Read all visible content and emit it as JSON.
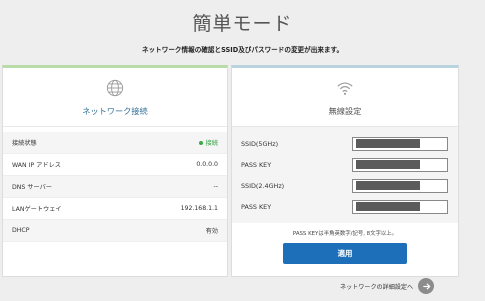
{
  "page": {
    "title": "簡単モード",
    "subtitle": "ネットワーク情報の確認とSSID及びパスワードの変更が出来ます。"
  },
  "network_card": {
    "icon": "globe-icon",
    "heading": "ネットワーク接続",
    "rows": [
      {
        "label": "接続状態",
        "value": "接続",
        "status": true
      },
      {
        "label": "WAN IP アドレス",
        "value": "0.0.0.0"
      },
      {
        "label": "DNS サーバー",
        "value": "--"
      },
      {
        "label": "LANゲートウェイ",
        "value": "192.168.1.1"
      },
      {
        "label": "DHCP",
        "value": "有効"
      }
    ]
  },
  "wireless_card": {
    "icon": "wifi-icon",
    "heading": "無線設定",
    "fields": [
      {
        "label": "SSID(5GHz)"
      },
      {
        "label": "PASS KEY"
      },
      {
        "label": "SSID(2.4GHz)"
      },
      {
        "label": "PASS KEY"
      }
    ],
    "note": "PASS KEYは半角英数字/記号, 8文字以上。",
    "apply_label": "適用"
  },
  "footer": {
    "detail_link": "ネットワークの詳細設定へ"
  },
  "colors": {
    "apply_button": "#1c6fb8",
    "status_ok": "#3aa84a",
    "network_accent": "#b9dba8",
    "wireless_accent": "#b9d3df"
  }
}
